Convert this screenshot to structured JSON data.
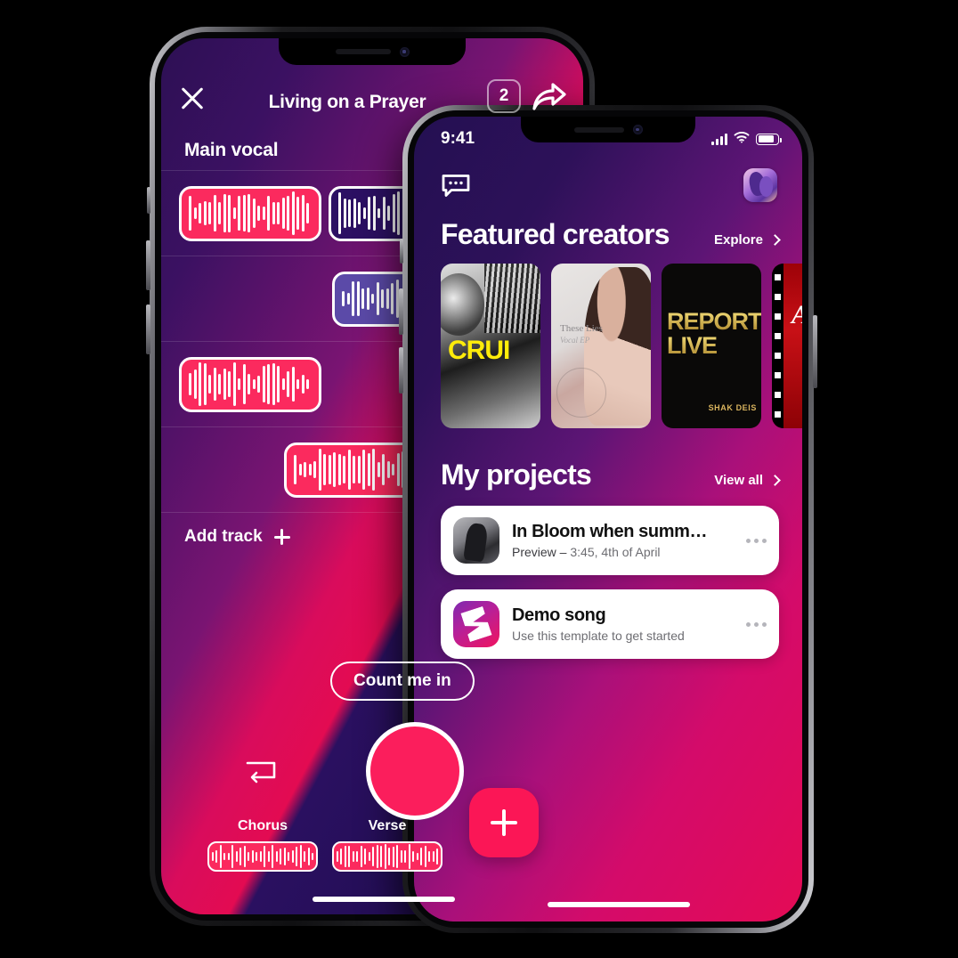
{
  "back_phone": {
    "header": {
      "close_icon": "close-x-icon",
      "title": "Living on a Prayer",
      "count_badge": "2",
      "share_icon": "share-arrow-icon"
    },
    "track_section_label": "Main vocal",
    "add_track_label": "Add track",
    "add_track_icon": "plus-icon",
    "count_in_label": "Count me in",
    "loop_icon": "loop-icon",
    "record_button": "record-button",
    "segments": [
      {
        "name": "Chorus"
      },
      {
        "name": "Verse"
      }
    ]
  },
  "front_phone": {
    "status_bar": {
      "time": "9:41",
      "cellular_icon": "cellular-bars-icon",
      "wifi_icon": "wifi-icon",
      "battery_icon": "battery-icon"
    },
    "top_bar": {
      "messages_icon": "chat-bubble-icon",
      "avatar": "user-avatar"
    },
    "featured": {
      "title": "Featured creators",
      "link_label": "Explore",
      "link_icon": "chevron-right-icon",
      "cards": [
        {
          "caption": "CRUI"
        },
        {
          "caption": "These Lies",
          "caption_sub": "Vocal EP"
        },
        {
          "caption_line1": "REPORT",
          "caption_line2": "LIVE",
          "caption_sub": "SHAK DEIS"
        },
        {
          "caption": "A"
        }
      ]
    },
    "projects": {
      "title": "My projects",
      "link_label": "View all",
      "link_icon": "chevron-right-icon",
      "items": [
        {
          "title": "In Bloom when summ…",
          "subtitle_lead": "Preview – ",
          "subtitle_rest": "3:45, 4th of April",
          "menu_icon": "more-options-icon"
        },
        {
          "title": "Demo song",
          "subtitle_lead": "",
          "subtitle_rest": "Use this template to get started",
          "menu_icon": "more-options-icon"
        }
      ]
    },
    "fab": "add-project-button"
  },
  "colors": {
    "accent_pink": "#fb1656",
    "deep_purple": "#241052",
    "magenta": "#d40b6a",
    "card_white": "#ffffff"
  }
}
